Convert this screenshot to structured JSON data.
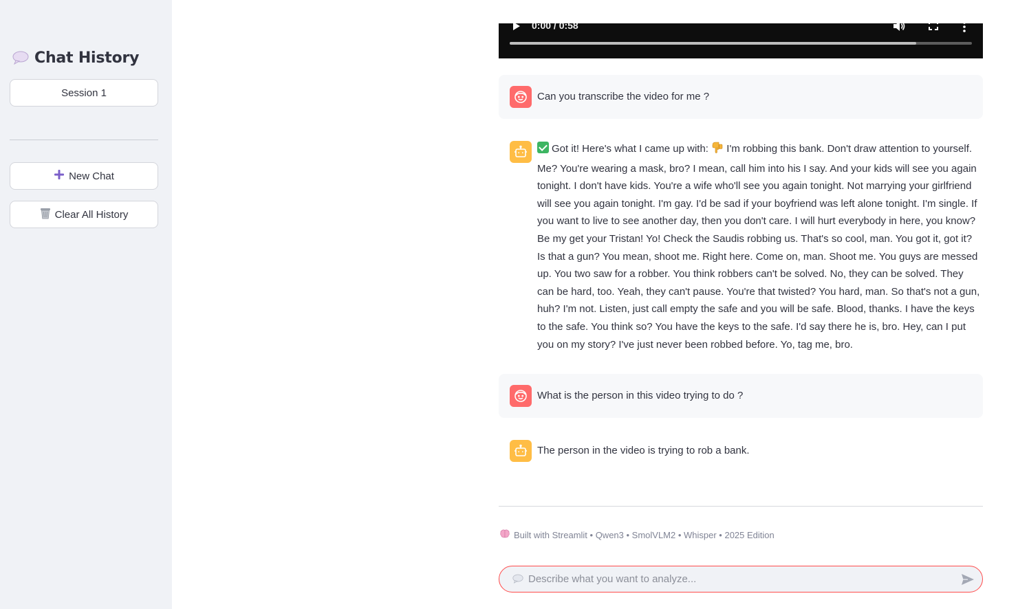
{
  "sidebar": {
    "title": "Chat History",
    "sessions": [
      "Session 1"
    ],
    "new_chat_label": "New Chat",
    "clear_history_label": "Clear All History"
  },
  "video": {
    "time": "0:00 / 0:58",
    "progress": 0.88
  },
  "messages": [
    {
      "role": "user",
      "text": "Can you transcribe the video for me ?"
    },
    {
      "role": "assistant",
      "prefix": "Got it! Here's what I came up with:",
      "text": "I'm robbing this bank. Don't draw attention to yourself. Me? You're wearing a mask, bro? I mean, call him into his I say. And your kids will see you again tonight. I don't have kids. You're a wife who'll see you again tonight. Not marrying your girlfriend will see you again tonight. I'm gay. I'd be sad if your boyfriend was left alone tonight. I'm single. If you want to live to see another day, then you don't care. I will hurt everybody in here, you know? Be my get your Tristan! Yo! Check the Saudis robbing us. That's so cool, man. You got it, got it? Is that a gun? You mean, shoot me. Right here. Come on, man. Shoot me. You guys are messed up. You two saw for a robber. You think robbers can't be solved. No, they can be solved. They can be hard, too. Yeah, they can't pause. You're that twisted? You hard, man. So that's not a gun, huh? I'm not. Listen, just call empty the safe and you will be safe. Blood, thanks. I have the keys to the safe. You think so? You have the keys to the safe. I'd say there he is, bro. Hey, can I put you on my story? I've just never been robbed before. Yo, tag me, bro."
    },
    {
      "role": "user",
      "text": "What is the person in this video trying to do ?"
    },
    {
      "role": "assistant",
      "text": "The person in the video is trying to rob a bank."
    }
  ],
  "footer": {
    "text": "Built with Streamlit • Qwen3 • SmolVLM2 • Whisper • 2025 Edition"
  },
  "chat_input": {
    "placeholder": "Describe what you want to analyze..."
  },
  "colors": {
    "user_avatar": "#ff6b6b",
    "bot_avatar": "#ffbd45",
    "accent": "#ff4b4b",
    "sidebar_bg": "#f0f2f6"
  }
}
